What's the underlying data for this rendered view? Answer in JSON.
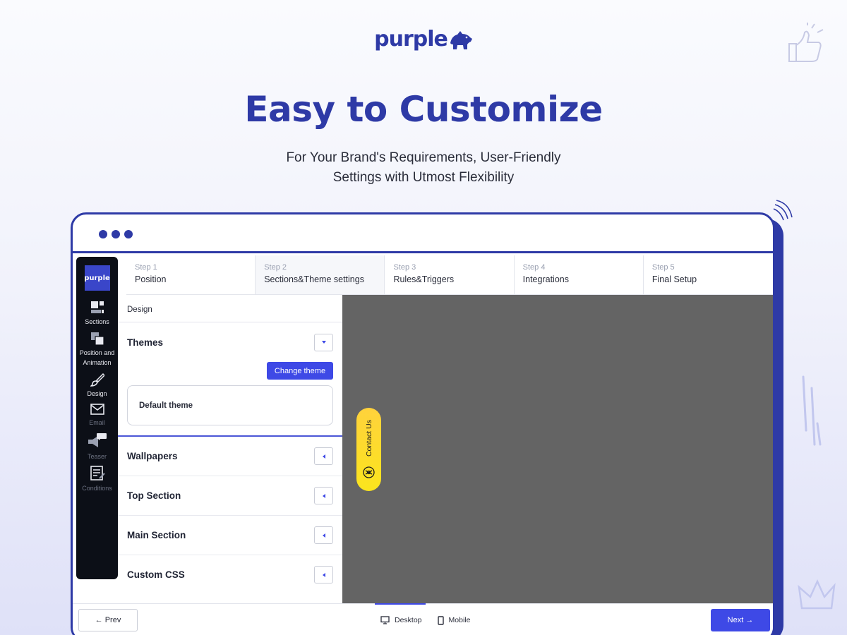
{
  "brand": {
    "name": "purple"
  },
  "hero": {
    "title": "Easy to Customize",
    "subtitle_line1": "For Your Brand's Requirements, User-Friendly",
    "subtitle_line2": "Settings with Utmost Flexibility"
  },
  "colors": {
    "brand": "#2e3aa6",
    "accent": "#3e49e6",
    "sidebar": "#0c0f17",
    "preview": "#646464",
    "contact": "#ffd23c"
  },
  "sidebar": {
    "logo": "purple",
    "items": [
      {
        "label": "Sections",
        "icon": "sections-icon"
      },
      {
        "label": "Position and Animation",
        "icon": "position-animation-icon"
      },
      {
        "label": "Design",
        "icon": "brush-icon"
      },
      {
        "label": "Email",
        "icon": "envelope-icon"
      },
      {
        "label": "Teaser",
        "icon": "megaphone-icon"
      },
      {
        "label": "Conditions",
        "icon": "conditions-icon"
      }
    ]
  },
  "steps": [
    {
      "num": "Step 1",
      "name": "Position"
    },
    {
      "num": "Step 2",
      "name": "Sections&Theme settings"
    },
    {
      "num": "Step 3",
      "name": "Rules&Triggers"
    },
    {
      "num": "Step 4",
      "name": "Integrations"
    },
    {
      "num": "Step 5",
      "name": "Final Setup"
    }
  ],
  "panel": {
    "heading": "Design",
    "themes_title": "Themes",
    "change_theme": "Change theme",
    "current_theme": "Default theme",
    "sections": [
      "Wallpapers",
      "Top Section",
      "Main Section",
      "Custom CSS"
    ]
  },
  "preview": {
    "contact_label": "Contact Us"
  },
  "bottom": {
    "prev": "← Prev",
    "next": "Next →",
    "desktop": "Desktop",
    "mobile": "Mobile"
  }
}
